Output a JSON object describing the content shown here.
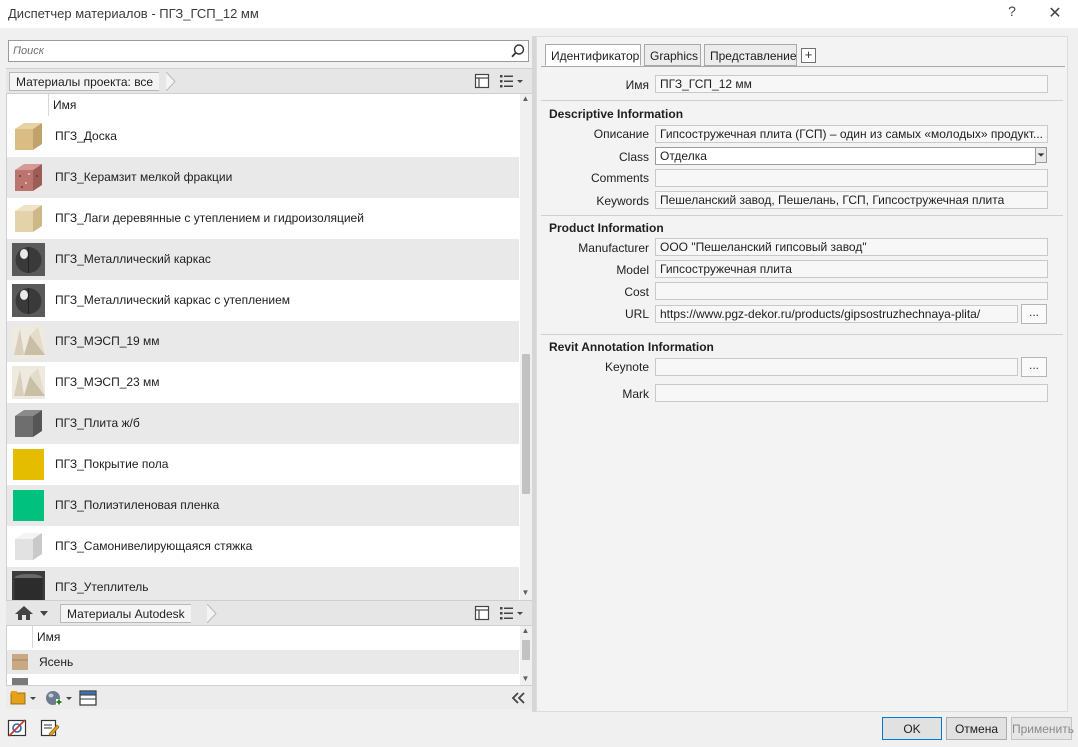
{
  "window": {
    "title": "Диспетчер материалов - ПГЗ_ГСП_12 мм",
    "help_glyph": "?",
    "close_glyph": "✕"
  },
  "search": {
    "placeholder": "Поиск",
    "value": ""
  },
  "project_bar": {
    "crumb": "Материалы проекта: все"
  },
  "project_list": {
    "header": "Имя",
    "rows": [
      {
        "label": "ПГЗ_Доска",
        "swatch": "wood-block"
      },
      {
        "label": "ПГЗ_Керамзит мелкой фракции",
        "swatch": "granite-block"
      },
      {
        "label": "ПГЗ_Лаги деревянные с утеплением и гидроизоляцией",
        "swatch": "light-wood-block"
      },
      {
        "label": "ПГЗ_Металлический каркас",
        "swatch": "metal-sphere"
      },
      {
        "label": "ПГЗ_Металлический каркас с утеплением",
        "swatch": "metal-sphere"
      },
      {
        "label": "ПГЗ_МЭСП_19 мм",
        "swatch": "panel-folds"
      },
      {
        "label": "ПГЗ_МЭСП_23 мм",
        "swatch": "panel-folds"
      },
      {
        "label": "ПГЗ_Плита ж/б",
        "swatch": "concrete-cube"
      },
      {
        "label": "ПГЗ_Покрытие пола",
        "swatch": "yellow-solid"
      },
      {
        "label": "ПГЗ_Полиэтиленовая пленка",
        "swatch": "green-solid"
      },
      {
        "label": "ПГЗ_Самонивелирующаяся стяжка",
        "swatch": "white-cube"
      },
      {
        "label": "ПГЗ_Утеплитель",
        "swatch": "dark-cylinder"
      }
    ]
  },
  "library_bar": {
    "crumb": "Материалы Autodesk"
  },
  "library_list": {
    "header": "Имя",
    "rows": [
      {
        "label": "Ясень",
        "swatch": "ash-wood"
      }
    ]
  },
  "tabs": {
    "items": [
      "Идентификатор",
      "Graphics",
      "Представление"
    ],
    "active": "Идентификатор",
    "add_glyph": "+"
  },
  "identity": {
    "name_label": "Имя",
    "name_value": "ПГЗ_ГСП_12 мм",
    "descriptive": {
      "title": "Descriptive Information",
      "description_label": "Описание",
      "description_value": "Гипсостружечная плита (ГСП) – один из самых «молодых» продукт...",
      "class_label": "Class",
      "class_value": "Отделка",
      "comments_label": "Comments",
      "comments_value": "",
      "keywords_label": "Keywords",
      "keywords_value": "Пешеланский завод, Пешелань, ГСП, Гипсостружечная плита"
    },
    "product": {
      "title": "Product Information",
      "manufacturer_label": "Manufacturer",
      "manufacturer_value": "ООО \"Пешеланский гипсовый завод\"",
      "model_label": "Model",
      "model_value": "Гипсостружечная плита",
      "cost_label": "Cost",
      "cost_value": "",
      "url_label": "URL",
      "url_value": "https://www.pgz-dekor.ru/products/gipsostruzhechnaya-plita/",
      "url_browse": "..."
    },
    "annotation": {
      "title": "Revit Annotation Information",
      "keynote_label": "Keynote",
      "keynote_value": "",
      "keynote_browse": "...",
      "mark_label": "Mark",
      "mark_value": ""
    }
  },
  "footer": {
    "ok": "OK",
    "cancel": "Отмена",
    "apply": "Применить"
  },
  "colors": {
    "active_button_border": "#0078d7",
    "alt_row": "#e9e9e9"
  }
}
